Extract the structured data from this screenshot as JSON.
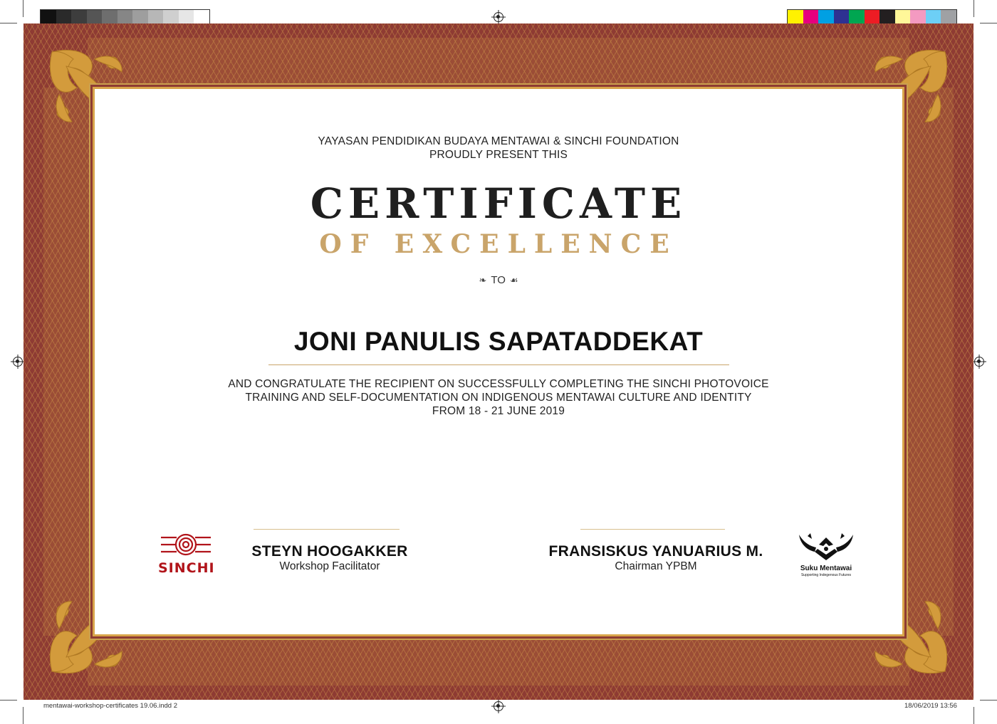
{
  "calibration": {
    "gray_swatches": [
      "#111111",
      "#2a2a2a",
      "#3d3d3d",
      "#555555",
      "#6e6e6e",
      "#868686",
      "#9e9e9e",
      "#b7b7b7",
      "#cfcfcf",
      "#e6e6e6",
      "#ffffff"
    ],
    "color_swatches": [
      "#fff200",
      "#e6007e",
      "#00a0e3",
      "#2e3192",
      "#00a651",
      "#ed1c24",
      "#231f20",
      "#fff799",
      "#f49ac1",
      "#6dcff6",
      "#9fa1a4"
    ]
  },
  "colors": {
    "border_red": "#8e3b33",
    "gold": "#c9a46a",
    "gold_frame": "#d8a54a"
  },
  "certificate": {
    "presenter_line1": "YAYASAN PENDIDIKAN BUDAYA MENTAWAI & SINCHI FOUNDATION",
    "presenter_line2": "PROUDLY PRESENT THIS",
    "title_main": "CERTIFICATE",
    "title_sub": "OF EXCELLENCE",
    "to_label": "TO",
    "recipient": "JONI PANULIS SAPATADDEKAT",
    "body_line1": "AND CONGRATULATE THE RECIPIENT ON SUCCESSFULLY COMPLETING THE SINCHI PHOTOVOICE",
    "body_line2": "TRAINING AND SELF-DOCUMENTATION ON INDIGENOUS MENTAWAI CULTURE AND IDENTITY",
    "body_line3": "FROM 18 - 21 JUNE 2019"
  },
  "signatories": {
    "left": {
      "name": "STEYN HOOGAKKER",
      "role": "Workshop Facilitator"
    },
    "right": {
      "name": "FRANSISKUS YANUARIUS M.",
      "role": "Chairman YPBM"
    }
  },
  "logos": {
    "left_word": "SINCHI",
    "right_word": "Suku Mentawai",
    "right_tagline": "Supporting Indegenous Futures"
  },
  "slug": {
    "file": "mentawai-workshop-certificates 19.06.indd   2",
    "timestamp": "18/06/2019   13:56"
  }
}
